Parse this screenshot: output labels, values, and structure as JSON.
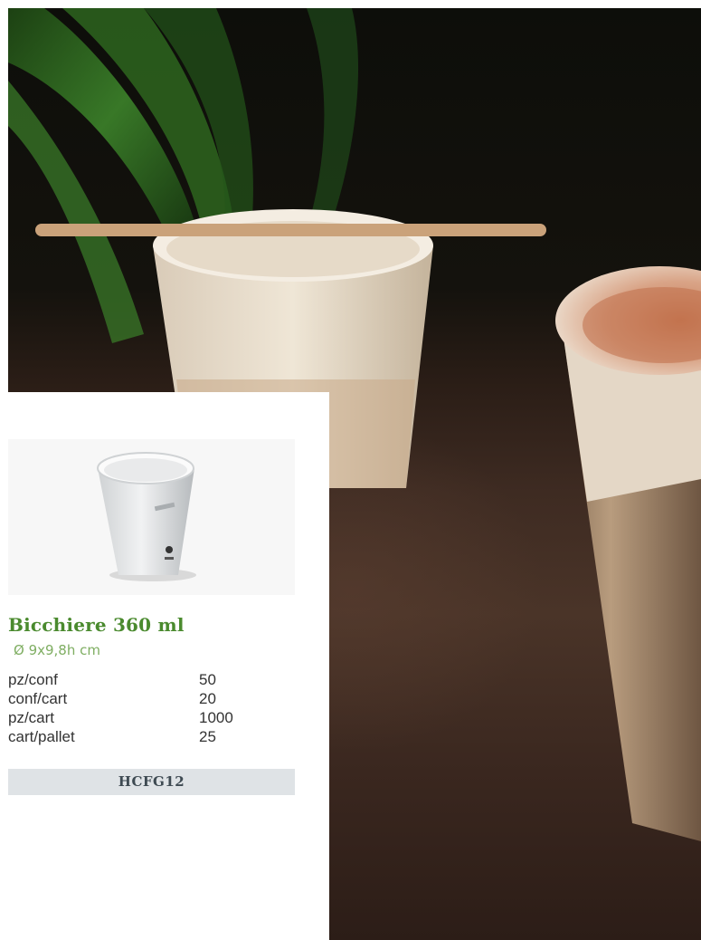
{
  "product": {
    "name": "Bicchiere 360 ml",
    "dimensions": "Ø 9x9,8h cm",
    "specs": [
      {
        "key": "pz/conf",
        "value": "50"
      },
      {
        "key": "conf/cart",
        "value": "20"
      },
      {
        "key": "pz/cart",
        "value": "1000"
      },
      {
        "key": "cart/pallet",
        "value": "25"
      }
    ],
    "code": "HCFG12"
  },
  "colors": {
    "title_green": "#4a8a2e",
    "dims_green": "#7fae62",
    "code_bar_bg": "#dfe3e6"
  },
  "images": {
    "background": "cappuccino-cups-photo",
    "product": "white-paper-cup-photo"
  }
}
